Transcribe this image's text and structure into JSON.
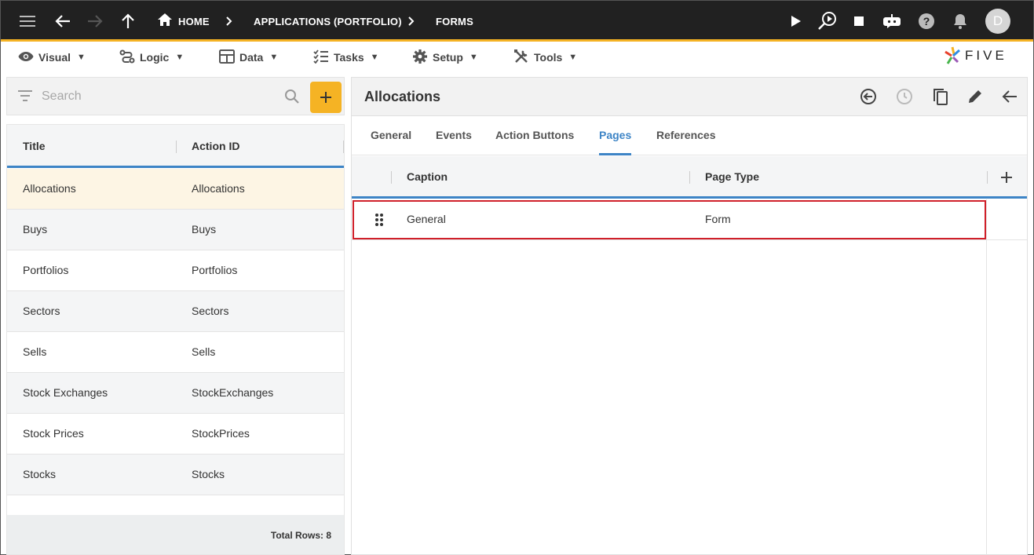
{
  "topbar": {
    "breadcrumbs": [
      "HOME",
      "APPLICATIONS (PORTFOLIO)",
      "FORMS"
    ],
    "avatar_initial": "D",
    "accent_color": "#f5b324"
  },
  "menu": {
    "items": [
      {
        "label": "Visual",
        "icon": "eye-icon"
      },
      {
        "label": "Logic",
        "icon": "logic-icon"
      },
      {
        "label": "Data",
        "icon": "table-icon"
      },
      {
        "label": "Tasks",
        "icon": "tasks-icon"
      },
      {
        "label": "Setup",
        "icon": "gear-icon"
      },
      {
        "label": "Tools",
        "icon": "tools-icon"
      }
    ],
    "caret": "▼",
    "logo_text": "FIVE"
  },
  "left": {
    "search_placeholder": "Search",
    "columns": [
      "Title",
      "Action ID"
    ],
    "rows": [
      {
        "title": "Allocations",
        "action_id": "Allocations"
      },
      {
        "title": "Buys",
        "action_id": "Buys"
      },
      {
        "title": "Portfolios",
        "action_id": "Portfolios"
      },
      {
        "title": "Sectors",
        "action_id": "Sectors"
      },
      {
        "title": "Sells",
        "action_id": "Sells"
      },
      {
        "title": "Stock Exchanges",
        "action_id": "StockExchanges"
      },
      {
        "title": "Stock Prices",
        "action_id": "StockPrices"
      },
      {
        "title": "Stocks",
        "action_id": "Stocks"
      }
    ],
    "total_rows": "Total Rows: 8"
  },
  "right": {
    "title": "Allocations",
    "tabs": [
      "General",
      "Events",
      "Action Buttons",
      "Pages",
      "References"
    ],
    "active_tab": "Pages",
    "columns": [
      "Caption",
      "Page Type"
    ],
    "rows": [
      {
        "caption": "General",
        "page_type": "Form"
      }
    ],
    "highlight_color": "#d0202a",
    "link_color": "#3d84c6"
  }
}
